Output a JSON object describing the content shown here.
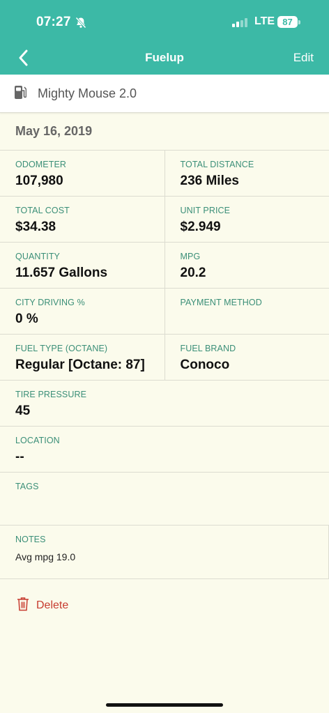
{
  "status": {
    "time": "07:27",
    "network": "LTE",
    "battery": "87"
  },
  "nav": {
    "title": "Fuelup",
    "edit_label": "Edit"
  },
  "vehicle": {
    "name": "Mighty Mouse 2.0"
  },
  "date": "May 16, 2019",
  "fields": {
    "odometer": {
      "label": "ODOMETER",
      "value": "107,980"
    },
    "total_distance": {
      "label": "TOTAL DISTANCE",
      "value": "236 Miles"
    },
    "total_cost": {
      "label": "TOTAL COST",
      "value": "$34.38"
    },
    "unit_price": {
      "label": "UNIT PRICE",
      "value": "$2.949"
    },
    "quantity": {
      "label": "QUANTITY",
      "value": "11.657 Gallons"
    },
    "mpg": {
      "label": "MPG",
      "value": "20.2"
    },
    "city_driving": {
      "label": "CITY DRIVING %",
      "value": "0 %"
    },
    "payment_method": {
      "label": "PAYMENT METHOD",
      "value": ""
    },
    "fuel_type": {
      "label": "FUEL TYPE (OCTANE)",
      "value": "Regular [Octane: 87]"
    },
    "fuel_brand": {
      "label": "FUEL BRAND",
      "value": "Conoco"
    },
    "tire_pressure": {
      "label": "TIRE PRESSURE",
      "value": "45"
    },
    "location": {
      "label": "LOCATION",
      "value": "--"
    },
    "tags": {
      "label": "TAGS",
      "value": ""
    },
    "notes": {
      "label": "NOTES",
      "value": "Avg mpg 19.0"
    }
  },
  "actions": {
    "delete_label": "Delete"
  },
  "colors": {
    "header": "#3cb9a6",
    "background": "#fbfbec",
    "label": "#3b8f78",
    "delete": "#c73b2f"
  },
  "icons": [
    "bell-slash-icon",
    "signal-icon",
    "battery-icon",
    "back-chevron-icon",
    "fuel-pump-icon",
    "trash-icon"
  ]
}
